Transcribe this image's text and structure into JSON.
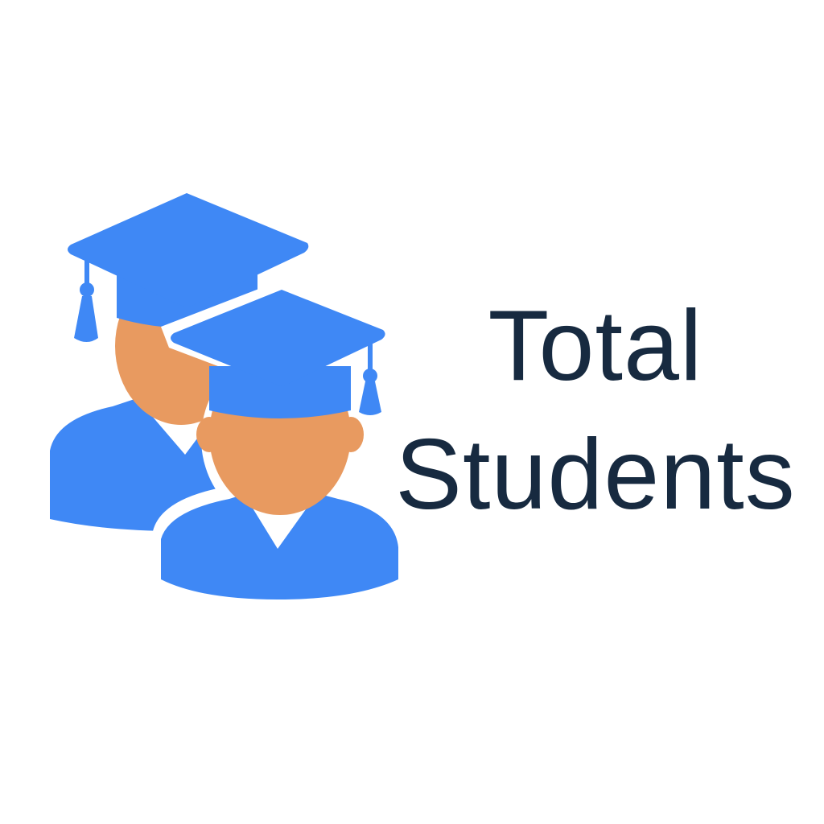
{
  "title": {
    "line1": "Total",
    "line2": "Students"
  },
  "icon": {
    "name": "graduate-students-icon",
    "cap_color": "#3f88f5",
    "gown_color": "#3f88f5",
    "skin_color": "#e89a60"
  },
  "colors": {
    "background": "#ffffff",
    "text": "#172a40",
    "accent": "#3f88f5"
  }
}
